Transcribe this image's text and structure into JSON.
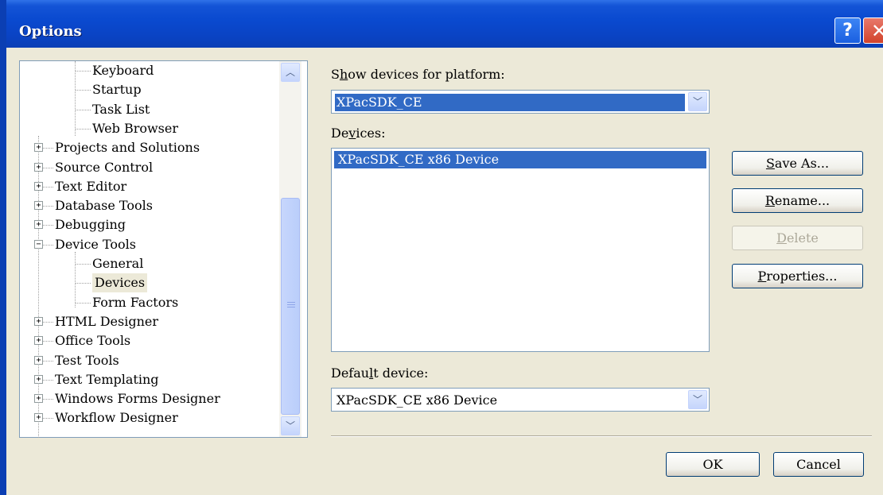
{
  "window": {
    "title": "Options",
    "help_glyph": "?",
    "close_glyph": "✕"
  },
  "tree": {
    "items": [
      {
        "label": "Keyboard",
        "level": 1,
        "expander": ""
      },
      {
        "label": "Startup",
        "level": 1,
        "expander": ""
      },
      {
        "label": "Task List",
        "level": 1,
        "expander": ""
      },
      {
        "label": "Web Browser",
        "level": 1,
        "expander": ""
      },
      {
        "label": "Projects and Solutions",
        "level": 0,
        "expander": "+"
      },
      {
        "label": "Source Control",
        "level": 0,
        "expander": "+"
      },
      {
        "label": "Text Editor",
        "level": 0,
        "expander": "+"
      },
      {
        "label": "Database Tools",
        "level": 0,
        "expander": "+"
      },
      {
        "label": "Debugging",
        "level": 0,
        "expander": "+"
      },
      {
        "label": "Device Tools",
        "level": 0,
        "expander": "−"
      },
      {
        "label": "General",
        "level": 1,
        "expander": ""
      },
      {
        "label": "Devices",
        "level": 1,
        "expander": "",
        "selected": true
      },
      {
        "label": "Form Factors",
        "level": 1,
        "expander": ""
      },
      {
        "label": "HTML Designer",
        "level": 0,
        "expander": "+"
      },
      {
        "label": "Office Tools",
        "level": 0,
        "expander": "+"
      },
      {
        "label": "Test Tools",
        "level": 0,
        "expander": "+"
      },
      {
        "label": "Text Templating",
        "level": 0,
        "expander": "+"
      },
      {
        "label": "Windows Forms Designer",
        "level": 0,
        "expander": "+"
      },
      {
        "label": "Workflow Designer",
        "level": 0,
        "expander": "+"
      }
    ],
    "scroll_up_glyph": "︿",
    "scroll_down_glyph": "﹀"
  },
  "platform": {
    "label_pre": "S",
    "label_accel": "h",
    "label_post": "ow devices for platform:",
    "value": "XPacSDK_CE",
    "arrow_glyph": "﹀"
  },
  "devices": {
    "label_pre": "De",
    "label_accel": "v",
    "label_post": "ices:",
    "items": [
      "XPacSDK_CE x86 Device"
    ]
  },
  "buttons": {
    "save_as": {
      "accel": "S",
      "rest": "ave As..."
    },
    "rename": {
      "accel": "R",
      "rest": "ename..."
    },
    "delete": {
      "accel": "D",
      "rest": "elete"
    },
    "properties": {
      "accel": "P",
      "rest": "roperties..."
    },
    "ok": "OK",
    "cancel": "Cancel"
  },
  "default_device": {
    "label_pre": "Defau",
    "label_accel": "l",
    "label_post": "t device:",
    "value": "XPacSDK_CE x86 Device",
    "arrow_glyph": "﹀"
  }
}
